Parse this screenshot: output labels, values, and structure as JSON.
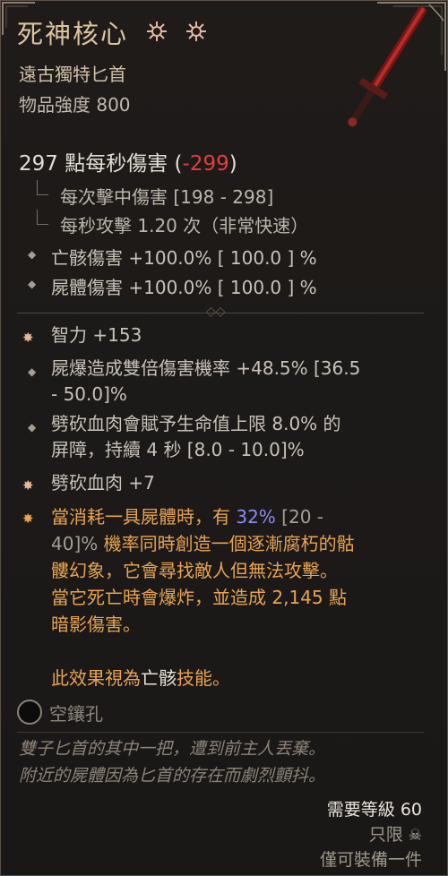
{
  "item": {
    "name": "死神核心",
    "type": "遠古獨特匕首",
    "power": "物品強度 800"
  },
  "damage": {
    "dps": "297 點每秒傷害",
    "paren_open": "(",
    "diff": "-299",
    "paren_close": ")",
    "per_hit": "每次擊中傷害 [198 - 298]",
    "attack_speed": "每秒攻擊 1.20 次（非常快速）"
  },
  "implicits": [
    "亡骸傷害 +100.0%  [ 100.0 ] %",
    "屍體傷害 +100.0%  [ 100.0 ] %"
  ],
  "affixes": {
    "intelligence": "智力 +153",
    "corpse_explosion": [
      "屍爆造成雙倍傷害機率 +48.5% [36.5",
      "- 50.0]%"
    ],
    "barrier": [
      "劈砍血肉會賦予生命值上限 8.0% 的",
      "屏障，持續 4 秒 [8.0 - 10.0]%"
    ],
    "hewed_flesh": "劈砍血肉 +7"
  },
  "unique": {
    "l1_a": "當消耗一具屍體時，有 ",
    "l1_pct": "32%",
    "l1_b": " [20 -",
    "l2_a": "40]%",
    "l2_b": " 機率同時創造一個逐漸腐朽的骷",
    "l3": "髏幻象，它會尋找敵人但無法攻擊。",
    "l4": "當它死亡時會爆炸，並造成 2,145 點",
    "l5": "暗影傷害。",
    "l6_a": "此效果視為",
    "l6_b": "亡骸",
    "l6_c": "技能。"
  },
  "socket": {
    "label": "空鑲孔"
  },
  "flavor": [
    "雙子匕首的其中一把，遭到前主人丟棄。",
    "附近的屍體因為匕首的存在而劇烈顫抖。"
  ],
  "requirements": {
    "level": "需要等級 60",
    "class": "只限",
    "equip": "僅可裝備一件"
  },
  "colors": {
    "accent": "#e8a452",
    "title": "#dcc4a0",
    "negative": "#e0403a",
    "highlight": "#8a8cf0"
  }
}
